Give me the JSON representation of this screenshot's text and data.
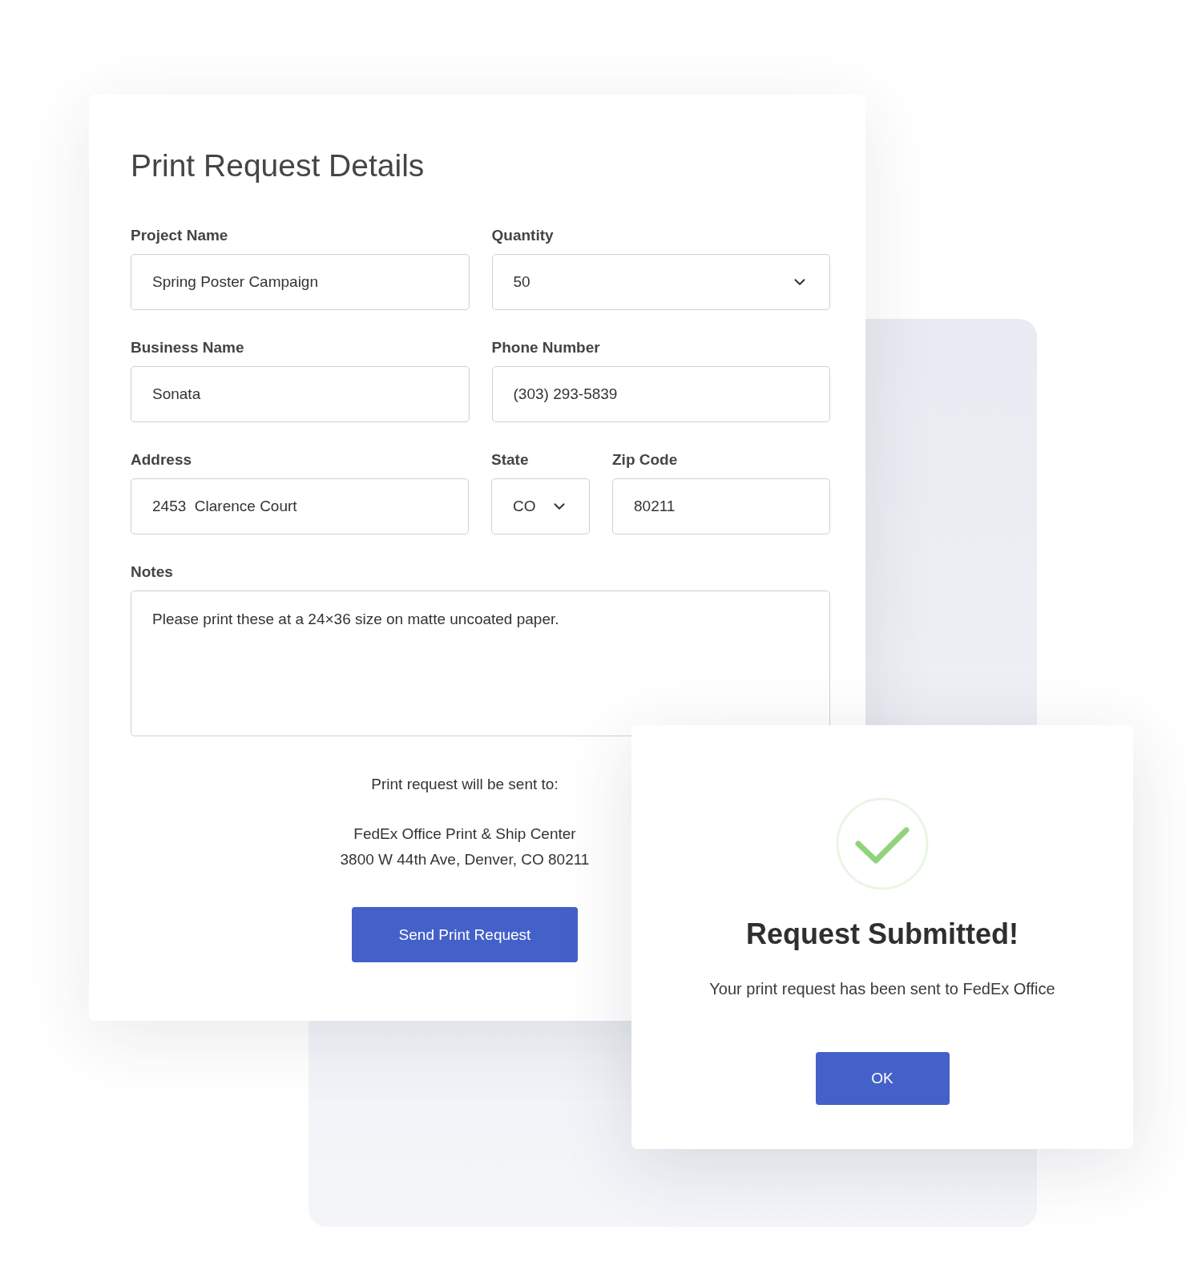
{
  "form": {
    "title": "Print Request Details",
    "rows": [
      {
        "fields": [
          {
            "kind": "text",
            "label": "Project Name",
            "value": "Spring Poster Campaign"
          },
          {
            "kind": "select",
            "label": "Quantity",
            "value": "50"
          }
        ]
      },
      {
        "fields": [
          {
            "kind": "text",
            "label": "Business Name",
            "value": "Sonata"
          },
          {
            "kind": "text",
            "label": "Phone Number",
            "value": "(303) 293-5839"
          }
        ]
      },
      {
        "fields": [
          {
            "kind": "text",
            "label": "Address",
            "value": "2453  Clarence Court"
          },
          {
            "kind": "select",
            "label": "State",
            "value": "CO"
          },
          {
            "kind": "text",
            "label": "Zip Code",
            "value": "80211"
          }
        ]
      },
      {
        "fields": [
          {
            "kind": "textarea",
            "label": "Notes",
            "value": "Please print these at a 24×36 size on matte uncoated paper."
          }
        ]
      }
    ],
    "recipient": {
      "heading": "Print request will be sent to:",
      "lines": [
        "FedEx Office Print & Ship Center",
        "3800 W 44th Ave, Denver, CO 80211"
      ]
    },
    "submit_button": "Send Print Request"
  },
  "dialog": {
    "title": "Request Submitted!",
    "message": "Your print request has been sent to FedEx Office",
    "button": "OK"
  }
}
